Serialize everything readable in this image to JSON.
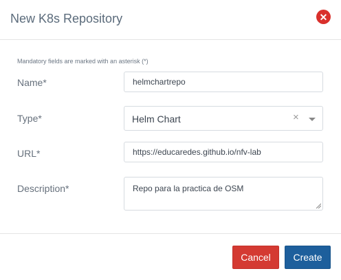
{
  "modal": {
    "title": "New K8s Repository",
    "close_icon": "close-icon",
    "close_glyph": "✕"
  },
  "form": {
    "mandatory_note": "Mandatory fields are marked with an asterisk (*)",
    "name": {
      "label": "Name*",
      "value": "helmchartrepo"
    },
    "type": {
      "label": "Type*",
      "value": "Helm Chart",
      "clear_glyph": "×"
    },
    "url": {
      "label": "URL*",
      "value": "https://educaredes.github.io/nfv-lab"
    },
    "description": {
      "label": "Description*",
      "value": "Repo para la practica de OSM"
    }
  },
  "footer": {
    "cancel_label": "Cancel",
    "create_label": "Create"
  },
  "colors": {
    "cancel": "#d43a32",
    "create": "#1d5f9c",
    "close": "#d9302c"
  }
}
